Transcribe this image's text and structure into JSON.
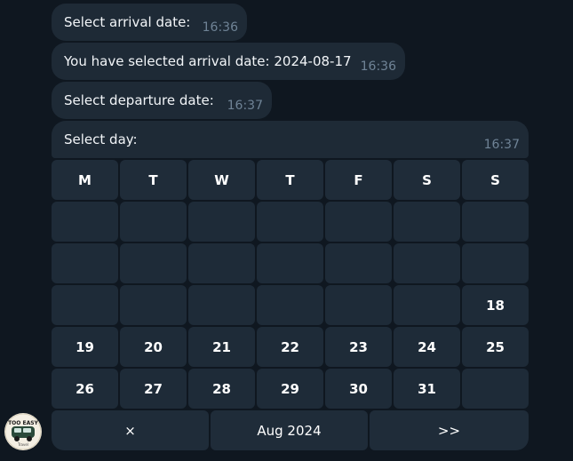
{
  "messages": [
    {
      "text": "Select arrival date:",
      "time": "16:36"
    },
    {
      "text": "You have selected arrival date: 2024-08-17",
      "time": "16:36"
    },
    {
      "text": "Select departure date:",
      "time": "16:37"
    },
    {
      "text": "Select day:",
      "time": "16:37"
    }
  ],
  "calendar": {
    "weekdays": [
      "M",
      "T",
      "W",
      "T",
      "F",
      "S",
      "S"
    ],
    "weeks": [
      [
        "",
        "",
        "",
        "",
        "",
        "",
        ""
      ],
      [
        "",
        "",
        "",
        "",
        "",
        "",
        ""
      ],
      [
        "",
        "",
        "",
        "",
        "",
        "",
        "18"
      ],
      [
        "19",
        "20",
        "21",
        "22",
        "23",
        "24",
        "25"
      ],
      [
        "26",
        "27",
        "28",
        "29",
        "30",
        "31",
        ""
      ]
    ],
    "nav": {
      "prev_label": "×",
      "month_label": "Aug 2024",
      "next_label": ">>"
    }
  },
  "avatar": {
    "brand_text": "TOO EASY",
    "sub_text": "Travel",
    "colors": {
      "bg": "#f4efe3",
      "van": "#2a4a3a"
    }
  },
  "colors": {
    "background": "#0f1720",
    "bubble": "#1e2a36",
    "button": "#1e2b38",
    "time": "#6f8396"
  }
}
